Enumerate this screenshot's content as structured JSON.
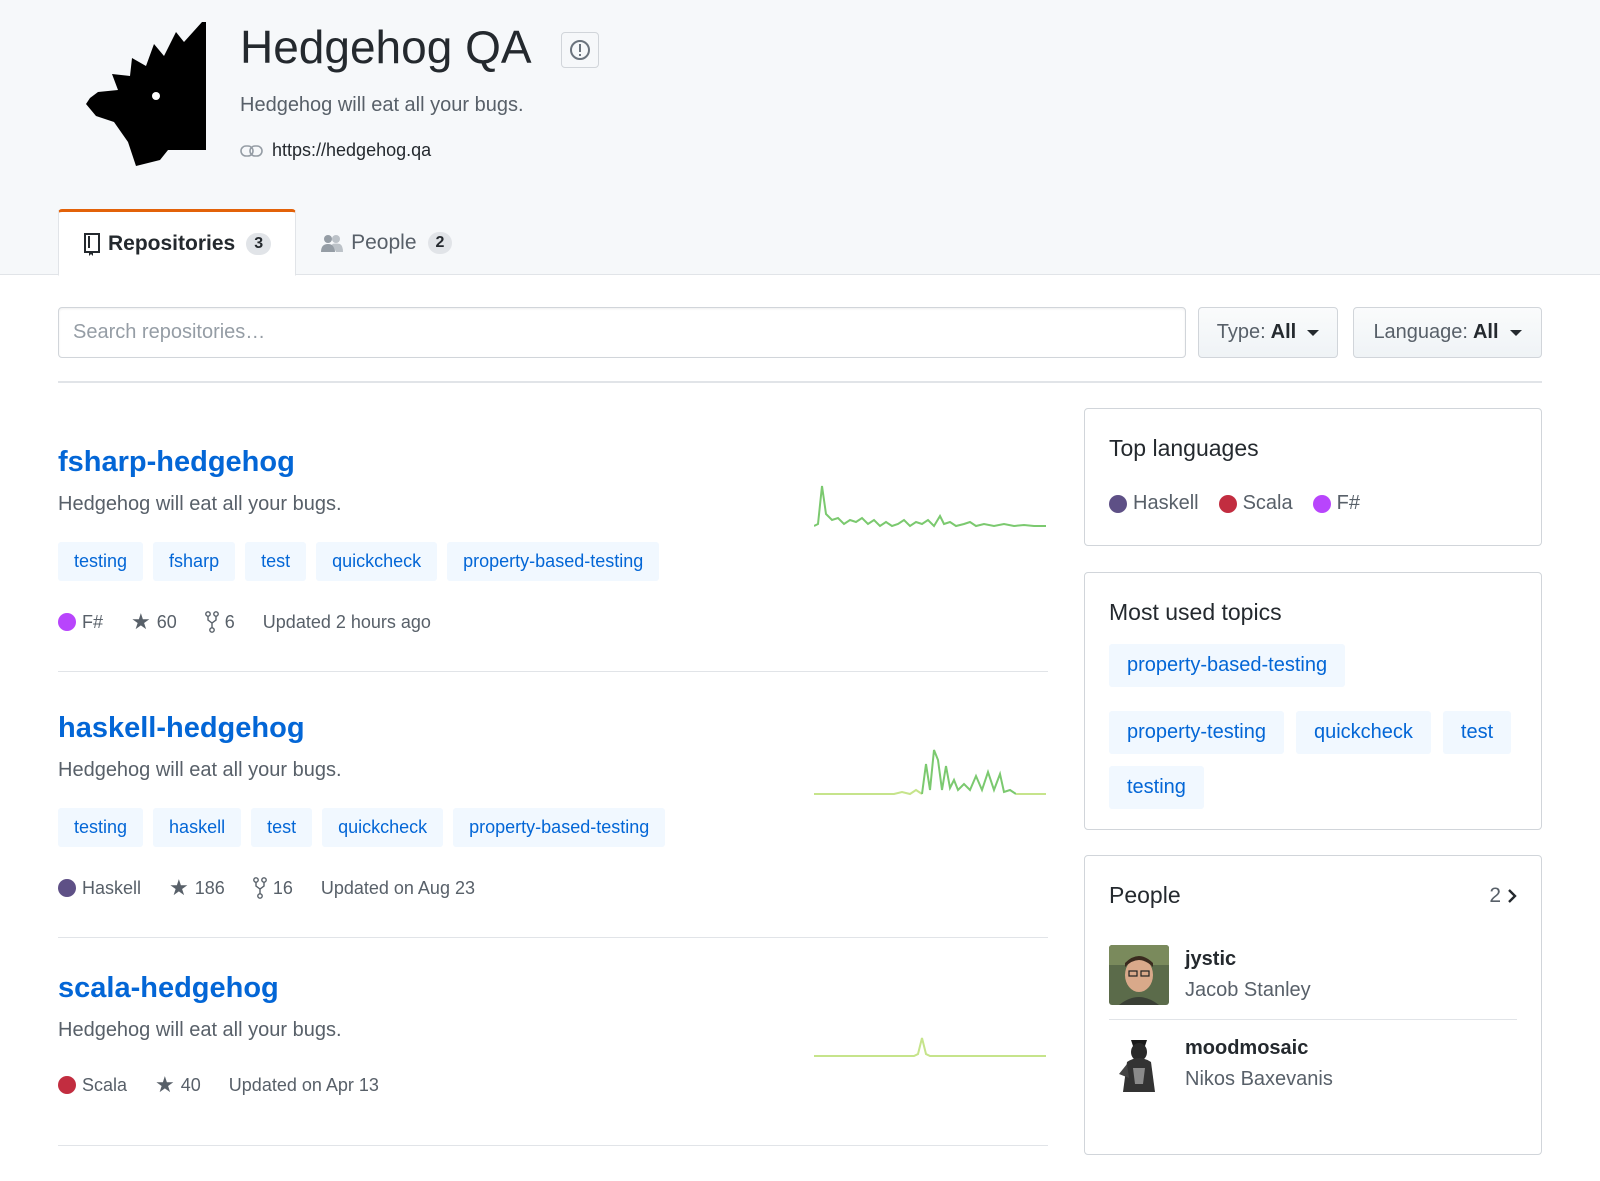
{
  "org": {
    "name": "Hedgehog QA",
    "description": "Hedgehog will eat all your bugs.",
    "url": "https://hedgehog.qa"
  },
  "tabs": [
    {
      "label": "Repositories",
      "count": "3"
    },
    {
      "label": "People",
      "count": "2"
    }
  ],
  "filters": {
    "search_placeholder": "Search repositories…",
    "type_label": "Type:",
    "type_value": "All",
    "language_label": "Language:",
    "language_value": "All"
  },
  "colors": {
    "accent": "#0366d6",
    "tab_underline": "#e36209",
    "fsharp": "#b845fc",
    "haskell": "#5e5086",
    "scala": "#c22d40",
    "spark": "#c6e48b",
    "spark_dark": "#7bc96f"
  },
  "repos": [
    {
      "name": "fsharp-hedgehog",
      "description": "Hedgehog will eat all your bugs.",
      "topics": [
        "testing",
        "fsharp",
        "test",
        "quickcheck",
        "property-based-testing"
      ],
      "language": "F#",
      "stars": "60",
      "forks": "6",
      "updated": "Updated 2 hours ago"
    },
    {
      "name": "haskell-hedgehog",
      "description": "Hedgehog will eat all your bugs.",
      "topics": [
        "testing",
        "haskell",
        "test",
        "quickcheck",
        "property-based-testing"
      ],
      "language": "Haskell",
      "stars": "186",
      "forks": "16",
      "updated": "Updated on Aug 23"
    },
    {
      "name": "scala-hedgehog",
      "description": "Hedgehog will eat all your bugs.",
      "topics": [],
      "language": "Scala",
      "stars": "40",
      "forks": "",
      "updated": "Updated on Apr 13"
    }
  ],
  "sidebar": {
    "top_languages_title": "Top languages",
    "top_languages": [
      "Haskell",
      "Scala",
      "F#"
    ],
    "topics_title": "Most used topics",
    "topics": [
      "property-based-testing",
      "property-testing",
      "quickcheck",
      "test",
      "testing"
    ],
    "people_title": "People",
    "people_count": "2",
    "people": [
      {
        "login": "jystic",
        "name": "Jacob Stanley"
      },
      {
        "login": "moodmosaic",
        "name": "Nikos Baxevanis"
      }
    ]
  }
}
